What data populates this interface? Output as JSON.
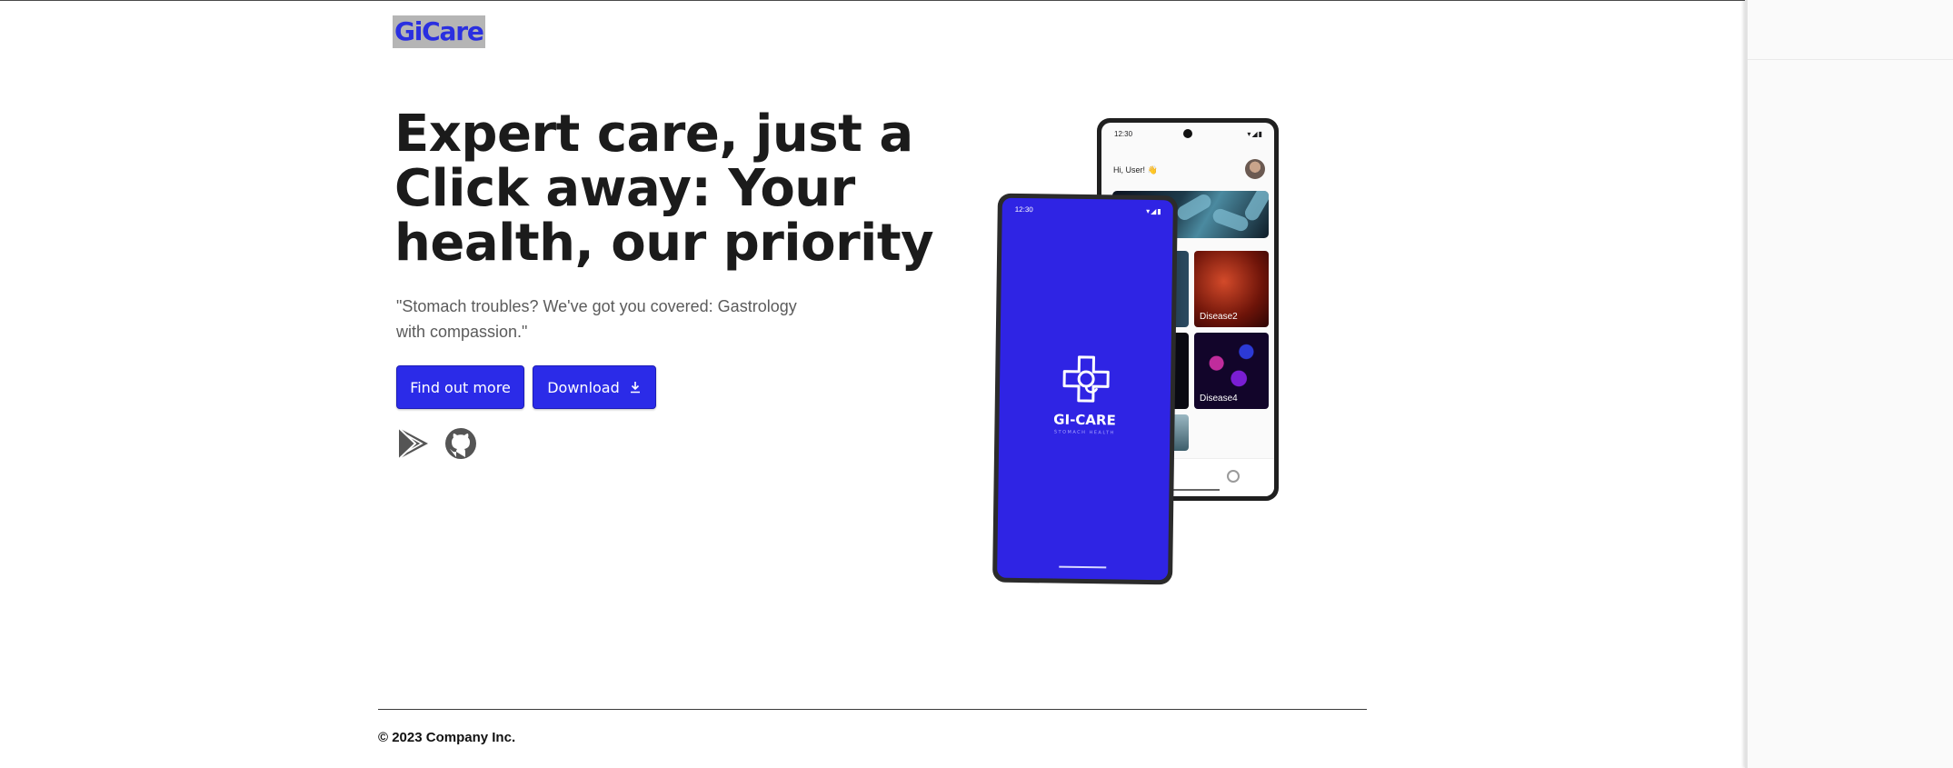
{
  "header": {
    "logo_text": "GiCare"
  },
  "hero": {
    "title_lines": [
      "Expert care, just a",
      "Click away: Your",
      "health, our priority"
    ],
    "subtitle_line1": "\"Stomach troubles? We've got you covered: Gastrology",
    "subtitle_line2": "with compassion.\""
  },
  "actions": {
    "find_out_more_label": "Find out more",
    "download_label": "Download",
    "download_icon": "download-icon",
    "store_links": [
      {
        "icon": "google-play-icon"
      },
      {
        "icon": "github-icon"
      }
    ]
  },
  "mockup": {
    "back_phone": {
      "time": "12:30",
      "greeting": "Hi, User! 👋",
      "tiles": [
        "Disease2",
        "Disease4"
      ]
    },
    "front_phone": {
      "time": "12:30",
      "brand_name": "GI-CARE",
      "brand_tagline": "STOMACH HEALTH"
    }
  },
  "footer": {
    "copyright": "© 2023 Company Inc."
  },
  "colors": {
    "accent": "#2b2be8",
    "text": "#1b1b1b",
    "muted": "#5b5b5b"
  }
}
